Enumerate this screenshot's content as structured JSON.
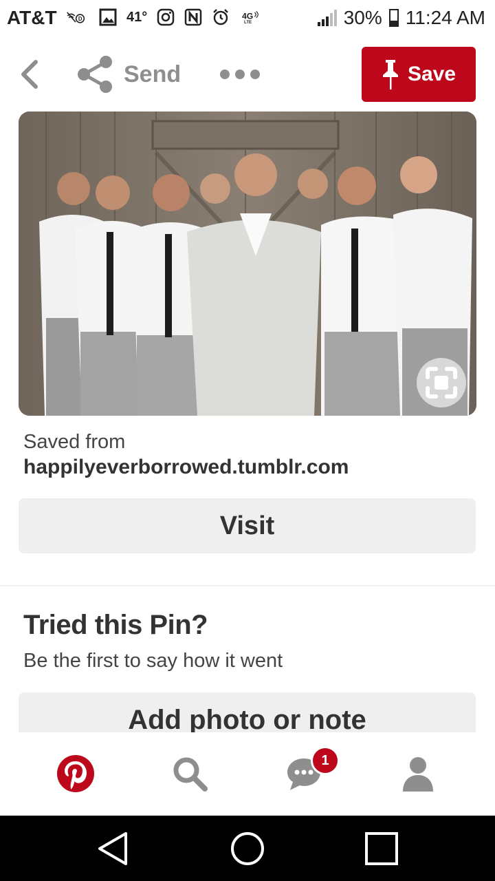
{
  "status_bar": {
    "carrier": "AT&T",
    "temperature": "41°",
    "battery_percent": "30%",
    "time": "11:24 AM",
    "icons": [
      "no-signal-d-icon",
      "image-icon",
      "instagram-icon",
      "nfc-icon",
      "alarm-icon",
      "4g-lte-icon",
      "signal-icon",
      "battery-icon"
    ]
  },
  "top_bar": {
    "send_label": "Send",
    "save_label": "Save"
  },
  "pin": {
    "saved_from_label": "Saved from",
    "source_domain": "happilyeverborrowed.tumblr.com",
    "visit_label": "Visit"
  },
  "tried": {
    "title": "Tried this Pin?",
    "subtitle": "Be the first to say how it went",
    "add_label": "Add photo or note"
  },
  "tab_bar": {
    "notification_count": "1",
    "tabs": [
      "pinterest-home-icon",
      "search-icon",
      "messages-icon",
      "profile-icon"
    ]
  },
  "colors": {
    "brand_red": "#bd081c",
    "button_gray": "#efefef",
    "text_dark": "#333333",
    "icon_gray": "#8e8e8e"
  }
}
